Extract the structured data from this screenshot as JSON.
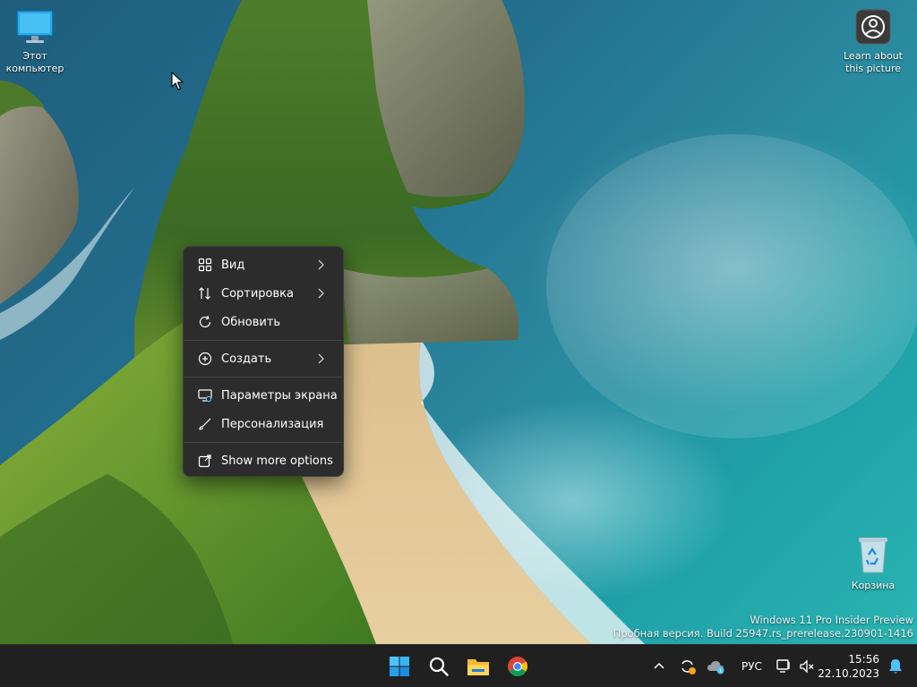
{
  "desktop": {
    "icons": [
      {
        "label_line1": "Этот",
        "label_line2": "компьютер",
        "icon": "monitor-icon"
      },
      {
        "label_line1": "Learn about",
        "label_line2": "this picture",
        "icon": "camera-info-icon"
      },
      {
        "label_line1": "Корзина",
        "label_line2": "",
        "icon": "recycle-bin-icon"
      }
    ]
  },
  "context_menu": {
    "items": [
      {
        "label": "Вид",
        "icon": "grid-icon",
        "has_submenu": true
      },
      {
        "label": "Сортировка",
        "icon": "sort-arrows-icon",
        "has_submenu": true
      },
      {
        "label": "Обновить",
        "icon": "refresh-icon",
        "has_submenu": false
      },
      {
        "label": "Создать",
        "icon": "plus-circle-icon",
        "has_submenu": true
      },
      {
        "label": "Параметры экрана",
        "icon": "display-settings-icon",
        "has_submenu": false
      },
      {
        "label": "Персонализация",
        "icon": "brush-icon",
        "has_submenu": false
      },
      {
        "label": "Show more options",
        "icon": "open-external-icon",
        "has_submenu": false
      }
    ]
  },
  "watermark": {
    "line1": "Windows 11 Pro Insider Preview",
    "line2": "Пробная версия. Build 25947.rs_prerelease.230901-1416"
  },
  "taskbar": {
    "apps": [
      "start-icon",
      "search-icon",
      "file-explorer-icon",
      "chrome-icon"
    ],
    "tray": {
      "chevron": "chevron-up-icon",
      "language": "РУС",
      "time": "15:56",
      "date": "22.10.2023"
    }
  },
  "colors": {
    "menu_bg": "#2c2c2c",
    "taskbar_bg": "#202020",
    "accent": "#0078d4"
  }
}
